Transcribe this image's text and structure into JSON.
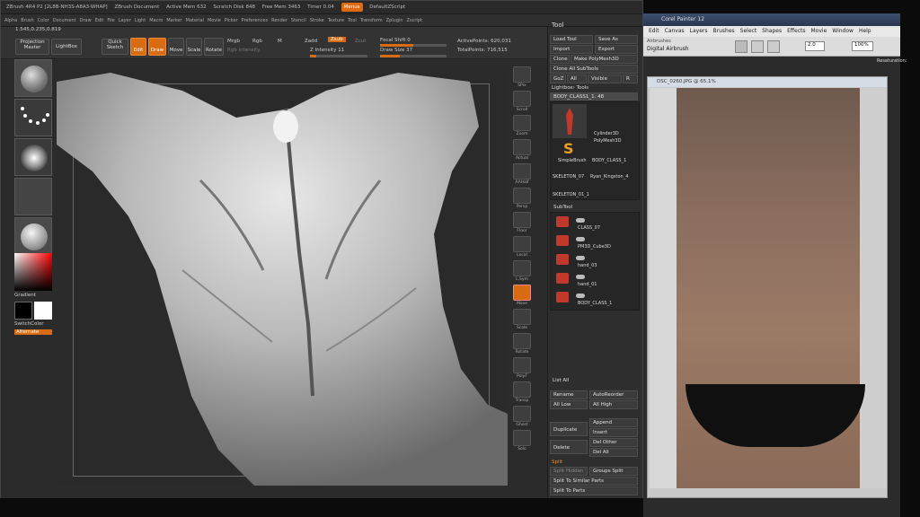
{
  "zbrush": {
    "title": "ZBrush 4R4 P2 [2L8B-NH3S-A8A3-WHAP]",
    "document": "ZBrush Document",
    "active_mem": "Active Mem 632",
    "scratch_disk": "Scratch Disk 848",
    "free_mem": "Free Mem 3463",
    "timer": "Timer 0.04",
    "menus_btn": "Menus",
    "script": "DefaultZScript",
    "menus": [
      "Alpha",
      "Brush",
      "Color",
      "Document",
      "Draw",
      "Edit",
      "File",
      "Layer",
      "Light",
      "Macro",
      "Marker",
      "Material",
      "Movie",
      "Picker",
      "Preferences",
      "Render",
      "Stencil",
      "Stroke",
      "Texture",
      "Tool",
      "Transform",
      "Zplugin",
      "Zscript"
    ],
    "coords": "1.545,0.235,0.819",
    "shelf": {
      "projection_master": "Projection Master",
      "lightbox": "LightBox",
      "quick_sketch": "Quick Sketch",
      "edit": "Edit",
      "draw": "Draw",
      "move": "Move",
      "scale": "Scale",
      "rotate": "Rotate",
      "mrgb": "Mrgb",
      "rgb": "Rgb",
      "m": "M",
      "zadd": "Zadd",
      "zsub": "Zsub",
      "zcut": "Zcut",
      "rgb_intensity": "Rgb Intensity",
      "z_intensity": "Z Intensity 11",
      "focal_shift": "Focal Shift 0",
      "draw_size": "Draw Size 37",
      "active_points": "ActivePoints: 620,031",
      "total_points": "TotalPoints: 716,515"
    },
    "left_tray": {
      "gradient": "Gradient",
      "switch_color": "SwitchColor",
      "alternate": "Alternate"
    },
    "right_tray": [
      "SPix",
      "Scroll",
      "Zoom",
      "Actual",
      "AAHalf",
      "Persp",
      "Floor",
      "Local",
      "L.Sym",
      "Move",
      "Scale",
      "Rotate",
      "PolyF",
      "Transp",
      "Ghost",
      "Solo"
    ],
    "tool_panel": {
      "header": "Tool",
      "load_tool": "Load Tool",
      "save_as": "Save As",
      "import": "Import",
      "export": "Export",
      "clone": "Clone",
      "make_polymesh": "Make PolyMesh3D",
      "clone_all": "Clone All SubTools",
      "goz": "GoZ",
      "all": "All",
      "visible": "Visible",
      "r": "R",
      "lightbox_tools": "Lightbox› Tools",
      "current_tool": "BODY_CLASS1_1. 48",
      "tools": [
        "Cylinder3D",
        "PolyMesh3D",
        "SimpleBrush",
        "BODY_CLASS_1",
        "SKELETON_07",
        "Ryan_Kingston_4",
        "SKELETON_01_1"
      ],
      "subtool": "SubTool",
      "subtools": [
        "CLASS_07",
        "PM3D_Cube3D",
        "hand_03",
        "hand_01",
        "BODY_CLASS_1"
      ],
      "list_all": "List All",
      "rename": "Rename",
      "auto_reorder": "AutoReorder",
      "all_low": "All Low",
      "all_high": "All High",
      "duplicate": "Duplicate",
      "append": "Append",
      "insert": "Insert",
      "delete": "Delete",
      "del_other": "Del Other",
      "del_all": "Del All",
      "split": "Split",
      "split_hidden": "Split Hidden",
      "groups_split": "Groups Split",
      "split_similar": "Split To Similar Parts",
      "split_parts": "Split To Parts"
    }
  },
  "painter": {
    "title": "Corel Painter 12",
    "menus": [
      "Edit",
      "Canvas",
      "Layers",
      "Brushes",
      "Select",
      "Shapes",
      "Effects",
      "Movie",
      "Window",
      "Help"
    ],
    "brush_category": "Airbrushes",
    "brush_variant": "Digital Airbrush",
    "size": "2.0",
    "opacity": "100%",
    "resaturation": "Resaturation:",
    "doc_title": "DSC_0260.JPG @ 65.1%"
  },
  "colors": {
    "accent": "#d96b12",
    "bg": "#2b2b2b"
  }
}
